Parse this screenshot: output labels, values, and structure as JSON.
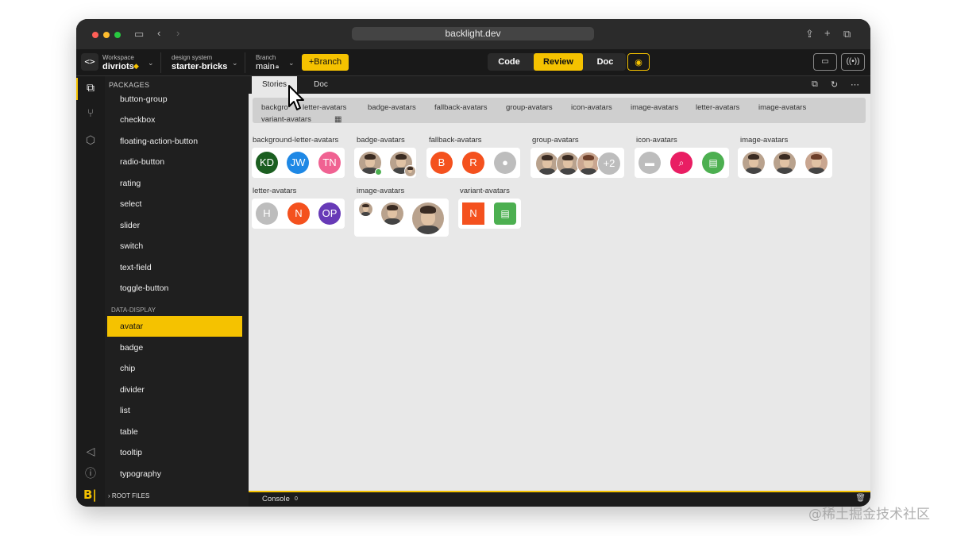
{
  "browser": {
    "url": "backlight.dev",
    "colors": {
      "close": "#fe5f57",
      "minimize": "#febc2e",
      "maximize": "#28c840"
    }
  },
  "appbar": {
    "workspace_label": "Workspace",
    "workspace_name": "divriots",
    "design_system_label": "design system",
    "design_system_name": "starter-bricks",
    "branch_label": "Branch",
    "branch_name": "main",
    "new_branch_label": "+Branch",
    "modes": [
      "Code",
      "Review",
      "Doc"
    ],
    "active_mode": "Review"
  },
  "sidebar": {
    "packages_heading": "PACKAGES",
    "items": [
      "button-group",
      "checkbox",
      "floating-action-button",
      "radio-button",
      "rating",
      "select",
      "slider",
      "switch",
      "text-field",
      "toggle-button"
    ],
    "section_heading": "DATA-DISPLAY",
    "data_items": [
      "avatar",
      "badge",
      "chip",
      "divider",
      "list",
      "table",
      "tooltip",
      "typography"
    ],
    "active_item": "avatar",
    "root_files_label": "ROOT FILES"
  },
  "tabs": [
    "Stories",
    "Doc"
  ],
  "active_tab": "Stories",
  "story_chips": [
    "background-letter-avatars",
    "badge-avatars",
    "fallback-avatars",
    "group-avatars",
    "icon-avatars",
    "image-avatars",
    "letter-avatars",
    "image-avatars",
    "variant-avatars"
  ],
  "story_chips_visible": [
    "backgro",
    "letter-avatars",
    "badge-avatars",
    "fallback-avatars",
    "group-avatars",
    "icon-avatars",
    "image-avatars",
    "letter-avatars",
    "image-avatars",
    "variant-avatars"
  ],
  "stories": {
    "background_letter_avatars": {
      "title": "background-letter-avatars",
      "letters": [
        "KD",
        "JW",
        "TN"
      ],
      "colors": [
        "#1b5e20",
        "#1e88e5",
        "#f06292"
      ]
    },
    "badge_avatars": {
      "title": "badge-avatars"
    },
    "fallback_avatars": {
      "title": "fallback-avatars",
      "letters": [
        "B",
        "R"
      ],
      "colors": [
        "#f4511e",
        "#f4511e",
        "#bdbdbd"
      ]
    },
    "group_avatars": {
      "title": "group-avatars",
      "extra": "+2"
    },
    "icon_avatars": {
      "title": "icon-avatars",
      "icons": [
        "folder-icon",
        "page-view-icon",
        "assignment-icon"
      ],
      "colors": [
        "#bdbdbd",
        "#e91e63",
        "#4caf50"
      ]
    },
    "image_avatars": {
      "title": "image-avatars"
    },
    "letter_avatars": {
      "title": "letter-avatars",
      "letters": [
        "H",
        "N",
        "OP"
      ],
      "colors": [
        "#bdbdbd",
        "#f4511e",
        "#673ab7"
      ]
    },
    "image_avatars_sizes": {
      "title": "image-avatars"
    },
    "variant_avatars": {
      "title": "variant-avatars",
      "letters": [
        "N"
      ],
      "colors": [
        "#f4511e",
        "#4caf50"
      ]
    }
  },
  "console": {
    "label": "Console",
    "count": "0"
  },
  "watermark": "@稀土掘金技术社区",
  "accent": "#f5c200"
}
